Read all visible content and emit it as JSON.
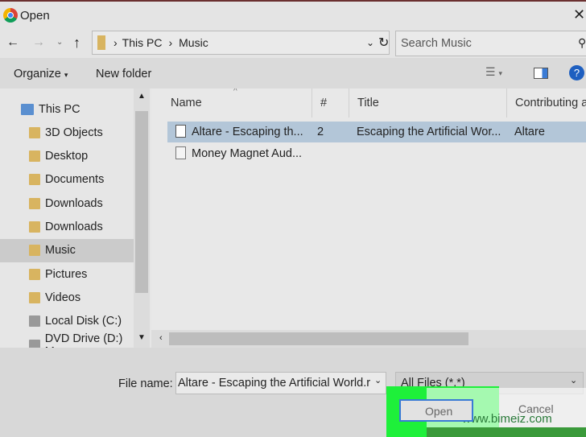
{
  "title": "Open",
  "address": {
    "path": [
      "This PC",
      "Music"
    ]
  },
  "search": {
    "placeholder": "Search Music"
  },
  "toolbar": {
    "organize": "Organize",
    "new_folder": "New folder"
  },
  "nav": [
    {
      "label": "This PC",
      "icon": "computer-icon"
    },
    {
      "label": "3D Objects",
      "icon": "folder-icon"
    },
    {
      "label": "Desktop",
      "icon": "folder-icon"
    },
    {
      "label": "Documents",
      "icon": "folder-icon"
    },
    {
      "label": "Downloads",
      "icon": "download-folder-icon"
    },
    {
      "label": "Downloads",
      "icon": "download-folder-icon"
    },
    {
      "label": "Music",
      "icon": "music-folder-icon",
      "selected": true
    },
    {
      "label": "Pictures",
      "icon": "folder-icon"
    },
    {
      "label": "Videos",
      "icon": "folder-icon"
    },
    {
      "label": "Local Disk (C:)",
      "icon": "drive-icon"
    },
    {
      "label": "DVD Drive (D:) M",
      "icon": "dvd-icon"
    }
  ],
  "columns": [
    "Name",
    "#",
    "Title",
    "Contributing a"
  ],
  "files": [
    {
      "name": "Altare - Escaping th...",
      "num": "2",
      "title": "Escaping the Artificial Wor...",
      "artist": "Altare",
      "selected": true
    },
    {
      "name": "Money Magnet Aud...",
      "num": "",
      "title": "",
      "artist": ""
    }
  ],
  "bottom": {
    "file_name_label": "File name:",
    "file_name_value": "Altare - Escaping the Artificial World.r",
    "file_type": "All Files (*.*)",
    "open": "Open",
    "cancel": "Cancel"
  },
  "watermark": "www.bimeiz.com"
}
